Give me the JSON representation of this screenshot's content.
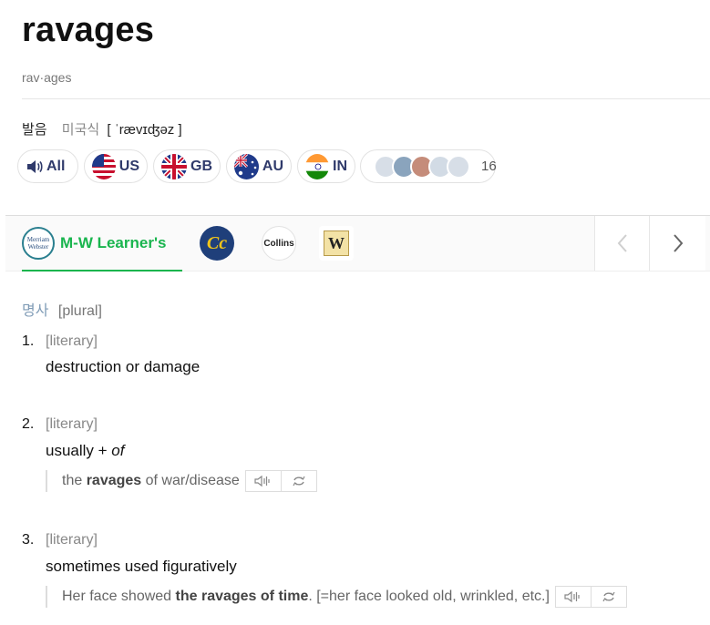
{
  "entry": {
    "word": "ravages",
    "syllables": "rav·ages",
    "pron_label": "발음",
    "pron_region": "미국식",
    "pron_ipa": "[ ˈrævɪʤəz ]"
  },
  "audio_pills": [
    {
      "label": "All",
      "icon": "speaker-icon"
    },
    {
      "label": "US",
      "icon": "us-flag-icon"
    },
    {
      "label": "GB",
      "icon": "gb-flag-icon"
    },
    {
      "label": "AU",
      "icon": "au-flag-icon"
    },
    {
      "label": "IN",
      "icon": "in-flag-icon"
    }
  ],
  "contributors_count": "16",
  "dictionaries": {
    "active": "M-W Learner's",
    "active_logo_text": "Merriam Webster",
    "others": [
      {
        "logo_text": "Cc",
        "icon": "cambridge-collins-logo-icon"
      },
      {
        "logo_text": "Collins",
        "icon": "collins-logo-icon"
      },
      {
        "logo_text": "W",
        "icon": "wordsmyth-logo-icon"
      }
    ],
    "accent_color": "#19b54e"
  },
  "definition": {
    "pos_ko": "명사",
    "pos_tag": "[plural]",
    "senses": [
      {
        "num": "1.",
        "register": "[literary]",
        "text": "destruction or damage"
      },
      {
        "num": "2.",
        "register": "[literary]",
        "text_pre": "usually + ",
        "text_em": "of",
        "example_pre": "the ",
        "example_bold": "ravages",
        "example_post": " of war/disease"
      },
      {
        "num": "3.",
        "register": "[literary]",
        "text": "sometimes used figuratively",
        "example_pre": "Her face showed ",
        "example_bold": "the ravages of time",
        "example_post": ". [=her face looked old, wrinkled, etc.]"
      }
    ]
  }
}
